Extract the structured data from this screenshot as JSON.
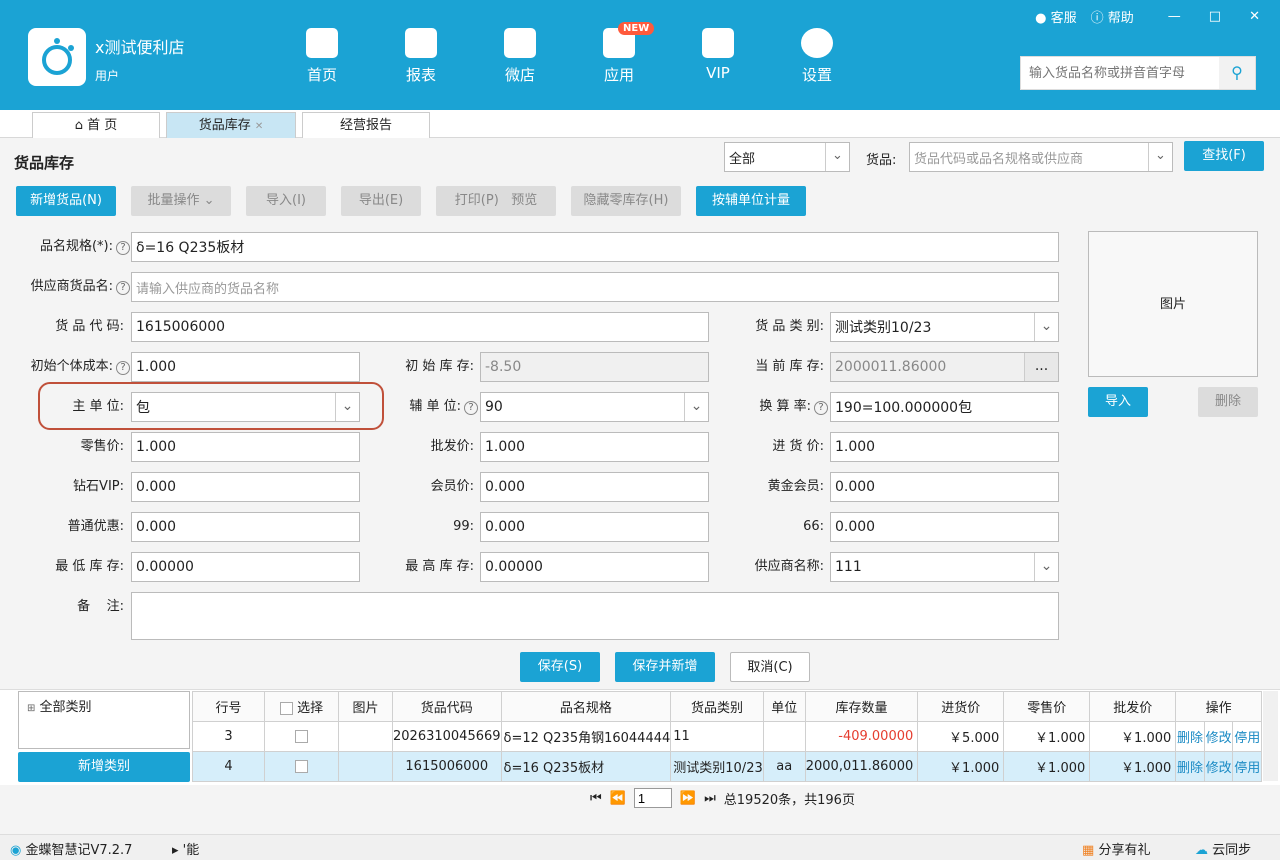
{
  "header": {
    "store_name": "x测试便利店",
    "role": "用户",
    "service": "客服",
    "help": "帮助",
    "nav": [
      {
        "label": "首页",
        "icon": "home-icon"
      },
      {
        "label": "报表",
        "icon": "chart-icon"
      },
      {
        "label": "微店",
        "icon": "shop-icon"
      },
      {
        "label": "应用",
        "icon": "apps-icon"
      },
      {
        "label": "VIP",
        "icon": "crown-icon"
      },
      {
        "label": "设置",
        "icon": "gear-icon"
      }
    ],
    "new_badge": "NEW",
    "search_placeholder": "输入货品名称或拼音首字母"
  },
  "tabs": [
    {
      "label": "首 页"
    },
    {
      "label": "货品库存"
    },
    {
      "label": "经营报告"
    }
  ],
  "toolbar": {
    "title": "货品库存",
    "category": "全部",
    "goods_label": "货品:",
    "goods_placeholder": "货品代码或品名规格或供应商",
    "find": "查找(F)",
    "add": "新增货品(N)",
    "batch": "批量操作",
    "import": "导入(I)",
    "export": "导出(E)",
    "print": "打印(P)",
    "preview": "预览",
    "hide_zero": "隐藏零库存(H)",
    "aux_unit": "按辅单位计量"
  },
  "form": {
    "name_label": "品名规格(*):",
    "name": "δ=16 Q235板材",
    "supplier_name_label": "供应商货品名:",
    "supplier_name_placeholder": "请输入供应商的货品名称",
    "code_label": "货 品 代 码:",
    "code": "1615006000",
    "category_label": "货 品 类 别:",
    "category": "测试类别10/23",
    "init_cost_label": "初始个体成本:",
    "init_cost": "1.000",
    "init_stock_label": "初 始 库 存:",
    "init_stock": "-8.50",
    "cur_stock_label": "当 前 库 存:",
    "cur_stock": "2000011.86000",
    "more": "...",
    "main_unit_label": "主 单 位:",
    "main_unit": "包",
    "aux_unit_label": "辅 单 位:",
    "aux_unit": "90",
    "ratio_label": "换 算 率:",
    "ratio": "190=100.000000包",
    "retail_label": "零售价:",
    "retail": "1.000",
    "wholesale_label": "批发价:",
    "wholesale": "1.000",
    "purchase_label": "进 货 价:",
    "purchase": "1.000",
    "diamond_label": "钻石VIP:",
    "diamond": "0.000",
    "member_label": "会员价:",
    "member": "0.000",
    "gold_label": "黄金会员:",
    "gold": "0.000",
    "normal_label": "普通优惠:",
    "normal": "0.000",
    "p99_label": "99:",
    "p99": "0.000",
    "p66_label": "66:",
    "p66": "0.000",
    "min_stock_label": "最 低 库 存:",
    "min_stock": "0.00000",
    "max_stock_label": "最 高 库 存:",
    "max_stock": "0.00000",
    "supplier_label": "供应商名称:",
    "supplier": "111",
    "remark_label": "备    注:",
    "image": "图片",
    "img_import": "导入",
    "img_delete": "删除",
    "save": "保存(S)",
    "save_new": "保存并新增",
    "cancel": "取消(C)"
  },
  "tree": {
    "root": "全部类别",
    "add_category": "新增类别"
  },
  "grid": {
    "headers": [
      "行号",
      "选择",
      "图片",
      "货品代码",
      "品名规格",
      "货品类别",
      "单位",
      "库存数量",
      "进货价",
      "零售价",
      "批发价",
      "操作"
    ],
    "rows": [
      {
        "no": "3",
        "code": "2026310045669",
        "name": "δ=12 Q235角钢16044444",
        "cat": "11",
        "unit": "",
        "qty": "-409.00000",
        "buy": "￥5.000",
        "retail": "￥1.000",
        "whole": "￥1.000"
      },
      {
        "no": "4",
        "code": "1615006000",
        "name": "δ=16 Q235板材",
        "cat": "测试类别10/23",
        "unit": "aa",
        "qty": "2000,011.86000",
        "buy": "￥1.000",
        "retail": "￥1.000",
        "whole": "￥1.000"
      }
    ],
    "del": "删除",
    "edit": "修改",
    "disable": "停用"
  },
  "pager": {
    "page": "1",
    "summary": "总19520条，共196页"
  },
  "status": {
    "version": "金蝶智慧记V7.2.7",
    "func": "'能",
    "share": "分享有礼",
    "sync": "云同步"
  }
}
